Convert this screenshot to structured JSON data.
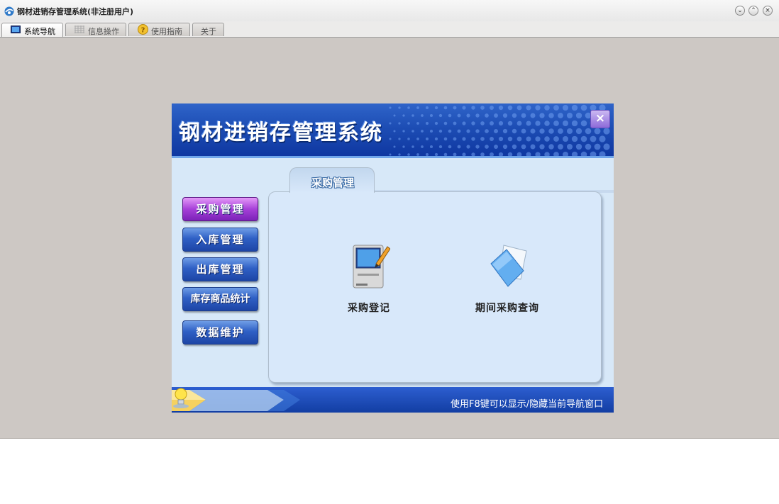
{
  "window": {
    "title": "钢材进销存管理系统(非注册用户)",
    "controls": [
      "minimize",
      "maximize",
      "close"
    ]
  },
  "tabs": [
    {
      "label": "系统导航",
      "icon": "monitor-icon",
      "active": true
    },
    {
      "label": "信息操作",
      "icon": "grid-icon",
      "active": false
    },
    {
      "label": "使用指南",
      "icon": "help-icon",
      "active": false
    },
    {
      "label": "关于",
      "icon": "",
      "active": false
    }
  ],
  "panel": {
    "title": "钢材进销存管理系统",
    "close_symbol": "×",
    "content_tab_label": "采购管理",
    "nav": [
      {
        "label": "采购管理",
        "active": true
      },
      {
        "label": "入库管理",
        "active": false
      },
      {
        "label": "出库管理",
        "active": false
      },
      {
        "label": "库存商品统计",
        "active": false
      },
      {
        "label": "数据维护",
        "active": false
      }
    ],
    "functions": [
      {
        "label": "采购登记",
        "icon": "computer-pencil-icon"
      },
      {
        "label": "期间采购查询",
        "icon": "document-folder-icon"
      }
    ],
    "footer_hint": "使用F8键可以显示/隐藏当前导航窗口"
  },
  "colors": {
    "header_blue": "#1d4db4",
    "nav_active": "#a640d8",
    "nav_normal": "#2f60c5",
    "window_bg": "#cdc8c4"
  }
}
